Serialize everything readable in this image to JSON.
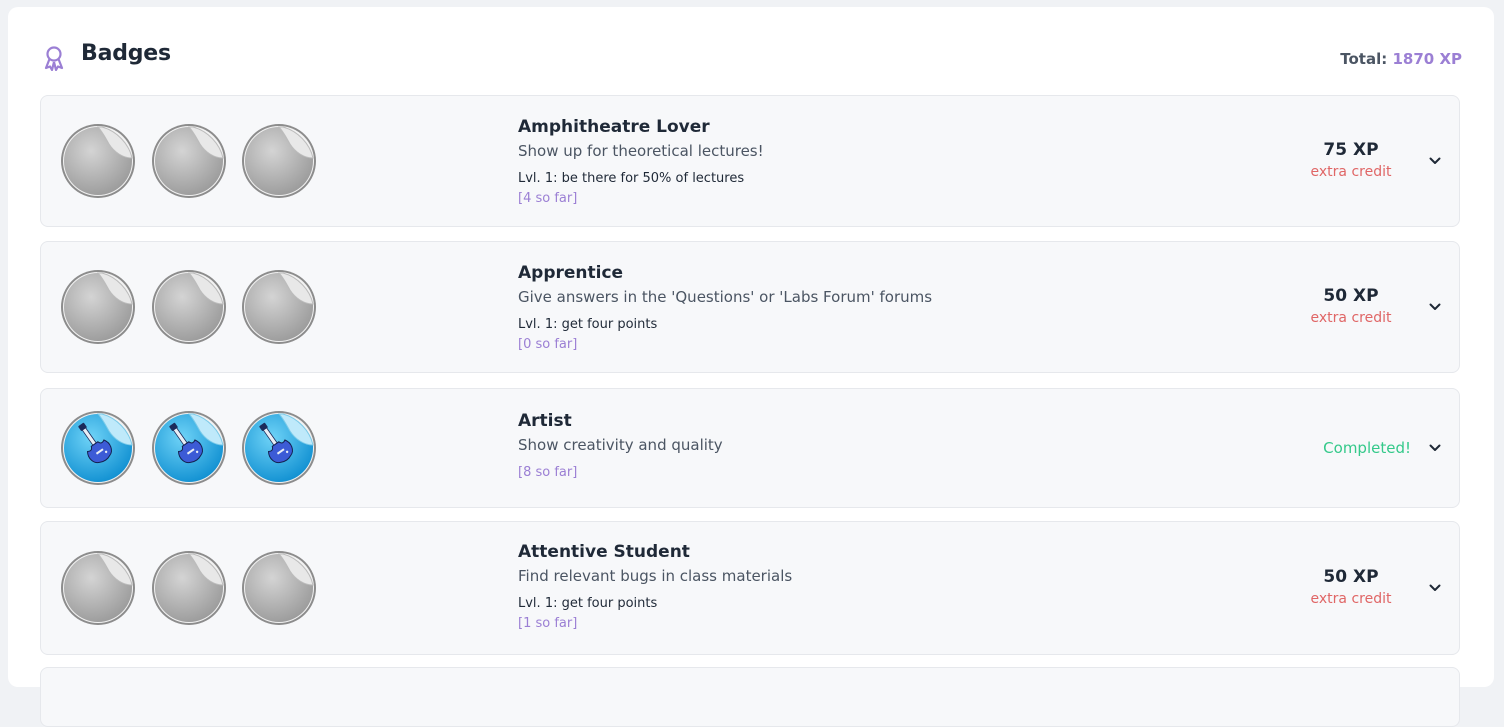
{
  "header": {
    "title": "Badges",
    "total_label": "Total:",
    "total_value": "1870 XP",
    "icon": "award-ribbon-icon"
  },
  "colors": {
    "accent": "#9b7fd4",
    "extra_credit": "#e06666",
    "completed": "#34c98a",
    "locked_badge": "#b8b8b8",
    "earned_badge": "#29a3de"
  },
  "badges": [
    {
      "title": "Amphitheatre Lover",
      "description": "Show up for theoretical lectures!",
      "level": "Lvl. 1: be there for 50% of lectures",
      "progress": "[4 so far]",
      "xp": "75 XP",
      "note": "extra credit",
      "completed": false
    },
    {
      "title": "Apprentice",
      "description": "Give answers in the 'Questions' or 'Labs Forum' forums",
      "level": "Lvl. 1: get four points",
      "progress": "[0 so far]",
      "xp": "50 XP",
      "note": "extra credit",
      "completed": false
    },
    {
      "title": "Artist",
      "description": "Show creativity and quality",
      "level": "",
      "progress": "[8 so far]",
      "status": "Completed!",
      "completed": true,
      "icon": "guitar-icon"
    },
    {
      "title": "Attentive Student",
      "description": "Find relevant bugs in class materials",
      "level": "Lvl. 1: get four points",
      "progress": "[1 so far]",
      "xp": "50 XP",
      "note": "extra credit",
      "completed": false
    }
  ]
}
